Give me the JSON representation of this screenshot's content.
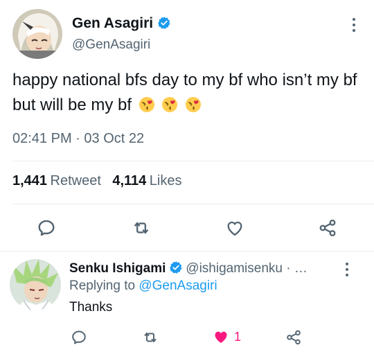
{
  "tweet": {
    "author_name": "Gen Asagiri",
    "author_handle": "@GenAsagiri",
    "text": "happy national bfs day to my bf who isn’t my bf but will be my bf",
    "emojis": [
      "kissing-heart-emoji",
      "kissing-heart-emoji",
      "kissing-heart-emoji"
    ],
    "time": "02:41 PM",
    "separator": "·",
    "date": "03 Oct 22",
    "retweets_count": "1,441",
    "retweets_label": "Retweet",
    "likes_count": "4,114",
    "likes_label": "Likes"
  },
  "reply": {
    "author_name": "Senku Ishigami",
    "author_handle": "@ishigamisenku · …",
    "replying_prefix": "Replying to",
    "replying_to": "@GenAsagiri",
    "text": "Thanks",
    "like_count": "1"
  },
  "colors": {
    "accent": "#1d9bf0",
    "secondary_text": "#536471",
    "like_red": "#f91880",
    "divider": "#e6ecf0"
  },
  "icons": [
    "verified-badge-icon",
    "more-options-icon",
    "reply-icon",
    "retweet-icon",
    "like-icon",
    "share-icon"
  ]
}
